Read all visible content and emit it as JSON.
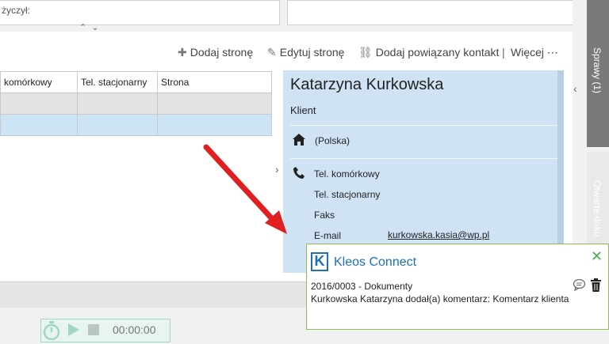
{
  "top": {
    "truncated_label": "życzył:"
  },
  "toolbar": {
    "add_page": "Dodaj stronę",
    "edit_page": "Edytuj stronę",
    "add_related": "Dodaj powiązany kontakt",
    "separator": "|",
    "more": "Więcej",
    "more_icon": "⋯"
  },
  "table": {
    "columns": [
      "komórkowy",
      "Tel. stacjonarny",
      "Strona"
    ]
  },
  "contact": {
    "name": "Katarzyna Kurkowska",
    "role": "Klient",
    "address": "(Polska)",
    "mobile_label": "Tel. komórkowy",
    "landline_label": "Tel. stacjonarny",
    "fax_label": "Faks",
    "email_label": "E-mail",
    "email_value": "kurkowska.kasia@wp.pl"
  },
  "side_tabs": {
    "sprawy": "Sprawy (1)",
    "otwarte": "Otwarte doku"
  },
  "timer": {
    "time": "00:00:00"
  },
  "notification": {
    "logo_letter": "K",
    "title": "Kleos Connect",
    "case": "2016/0003 - Dokumenty",
    "message": "Kurkowska Katarzyna dodał(a) komentarz: Komentarz klienta",
    "close_icon": "✕"
  },
  "colors": {
    "card_bg": "#cfe3f5",
    "accent": "#1f6fb8",
    "notif_border": "#8bc34a",
    "arrow": "#e02020"
  }
}
